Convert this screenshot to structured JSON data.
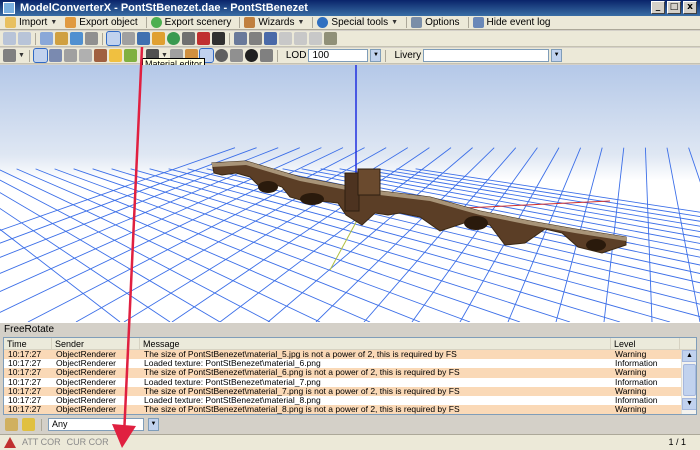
{
  "window": {
    "title": "ModelConverterX - PontStBenezet.dae - PontStBenezet",
    "min_label": "_",
    "max_label": "□",
    "close_label": "x"
  },
  "menu": {
    "import": "Import",
    "export_object": "Export object",
    "export_scenery": "Export scenery",
    "wizards": "Wizards",
    "special_tools": "Special tools",
    "options": "Options",
    "hide_event_log": "Hide event log"
  },
  "toolbar": {
    "lod_label": "LOD",
    "lod_value": "100",
    "livery_label": "Livery",
    "livery_value": "",
    "tooltip": "Material editor"
  },
  "viewport": {
    "mode": "FreeRotate"
  },
  "log": {
    "columns": [
      "Time",
      "Sender",
      "Message",
      "Level"
    ],
    "rows": [
      {
        "time": "10:17:27",
        "sender": "ObjectRenderer",
        "message": "The size of PontStBenezet\\material_5.jpg is not a power of 2, this is required by FS",
        "level": "Warning"
      },
      {
        "time": "10:17:27",
        "sender": "ObjectRenderer",
        "message": "Loaded texture: PontStBenezet\\material_6.png",
        "level": "Information"
      },
      {
        "time": "10:17:27",
        "sender": "ObjectRenderer",
        "message": "The size of PontStBenezet\\material_6.png is not a power of 2, this is required by FS",
        "level": "Warning"
      },
      {
        "time": "10:17:27",
        "sender": "ObjectRenderer",
        "message": "Loaded texture: PontStBenezet\\material_7.png",
        "level": "Information"
      },
      {
        "time": "10:17:27",
        "sender": "ObjectRenderer",
        "message": "The size of PontStBenezet\\material_7.png is not a power of 2, this is required by FS",
        "level": "Warning"
      },
      {
        "time": "10:17:27",
        "sender": "ObjectRenderer",
        "message": "Loaded texture: PontStBenezet\\material_8.png",
        "level": "Information"
      },
      {
        "time": "10:17:27",
        "sender": "ObjectRenderer",
        "message": "The size of PontStBenezet\\material_8.png is not a power of 2, this is required by FS",
        "level": "Warning"
      }
    ]
  },
  "filter": {
    "value": "Any"
  },
  "status": {
    "att": "ATT COR",
    "cur": "CUR COR",
    "page": "1 / 1"
  },
  "colors": {
    "warning_row": "#fad9b7",
    "information_row": "#ffffff",
    "grid": "#3c6fe8",
    "annotation_arrow": "#e02040"
  }
}
